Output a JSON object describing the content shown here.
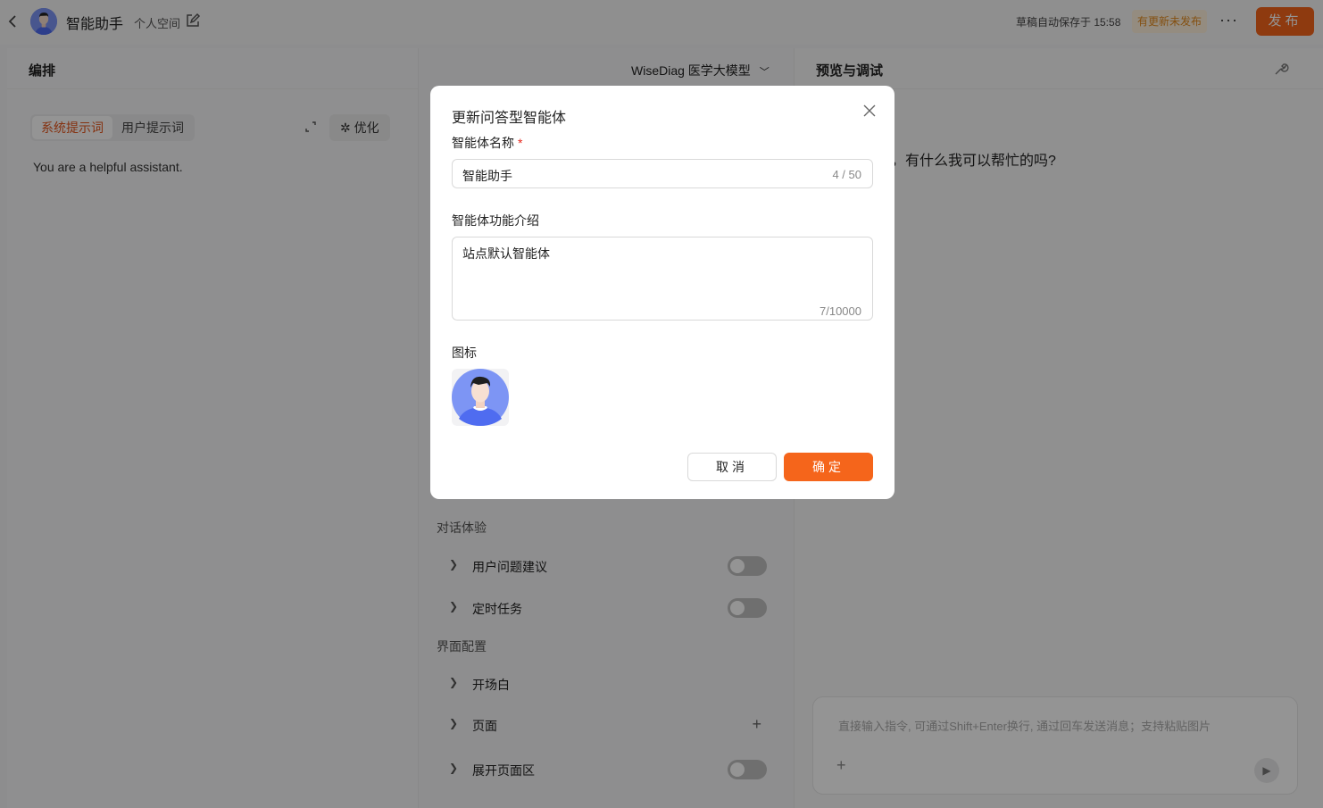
{
  "topbar": {
    "back_icon": "chevron-left-icon",
    "app_name": "智能助手",
    "space": "个人空间",
    "edit_icon": "edit-icon",
    "saved_status": "草稿自动保存于 15:58",
    "unpublished_badge": "有更新未发布",
    "more_label": "···",
    "publish_label": "发布"
  },
  "left_panel": {
    "title": "编排",
    "tabs": [
      {
        "label": "系统提示词",
        "active": true
      },
      {
        "label": "用户提示词",
        "active": false
      }
    ],
    "expand_icon": "expand-icon",
    "optimize_label": "优化",
    "optimize_icon": "magic-wand-icon",
    "prompt": "You are a helpful assistant."
  },
  "middle_panel": {
    "model_label": "WiseDiag 医学大模型",
    "sections": [
      {
        "title": "对话体验"
      },
      {
        "title": "界面配置"
      }
    ],
    "rows": [
      {
        "label": "用户问题建议",
        "control": "toggle",
        "on": false
      },
      {
        "label": "定时任务",
        "control": "toggle",
        "on": false
      },
      {
        "label": "开场白",
        "control": "none"
      },
      {
        "label": "页面",
        "control": "plus"
      },
      {
        "label": "展开页面区",
        "control": "toggle",
        "on": false
      }
    ]
  },
  "right_panel": {
    "title": "预览与调试",
    "settings_icon": "wrench-icon",
    "greeting": "，有什么我可以帮忙的吗?",
    "chat_placeholder": "直接输入指令, 可通过Shift+Enter换行, 通过回车发送消息；支持粘贴图片",
    "add_icon": "plus-icon",
    "send_icon": "send-icon"
  },
  "modal": {
    "title": "更新问答型智能体",
    "close_icon": "close-icon",
    "name_label": "智能体名称",
    "required_mark": "*",
    "name_value": "智能助手",
    "name_count": "4 / 50",
    "desc_label": "智能体功能介绍",
    "desc_value": "站点默认智能体",
    "desc_count": "7/10000",
    "icon_label": "图标",
    "cancel_label": "取消",
    "ok_label": "确定"
  },
  "colors": {
    "accent": "#f5651b",
    "badge_text": "#e38b1e",
    "avatar_bg": "#7d95f4"
  }
}
